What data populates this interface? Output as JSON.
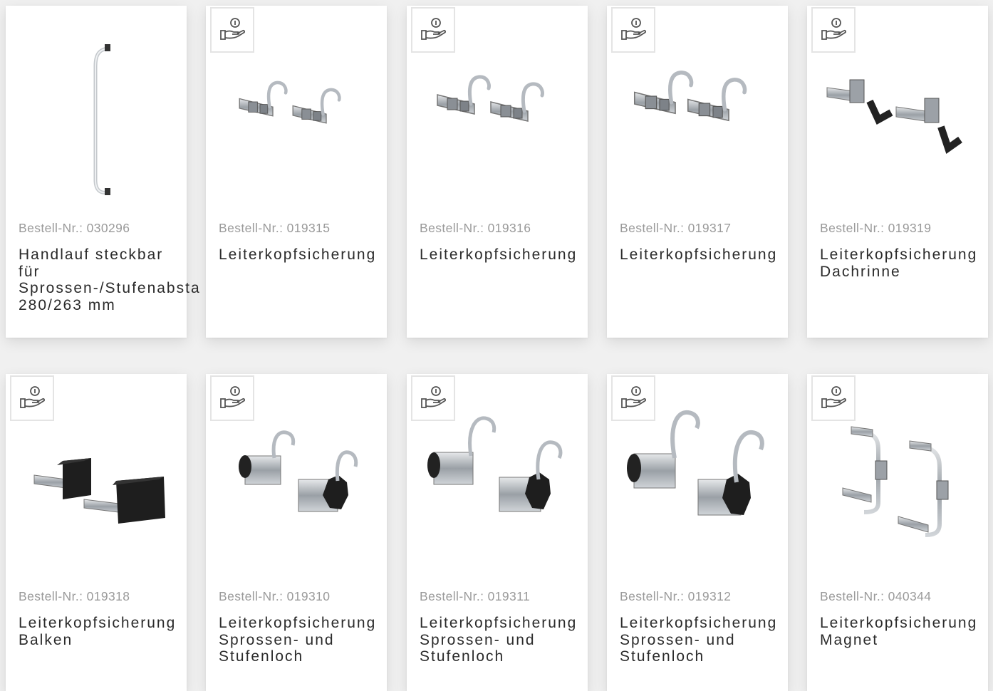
{
  "products": [
    {
      "sku": "Bestell-Nr.: 030296",
      "title": "Handlauf steckbar\nfür\nSprossen-/Stufenabsta\n280/263 mm",
      "badge": false,
      "image_icon": "handrail-image"
    },
    {
      "sku": "Bestell-Nr.: 019315",
      "title": "Leiterkopfsicherung",
      "badge": true,
      "image_icon": "ladder-hook-pair-image"
    },
    {
      "sku": "Bestell-Nr.: 019316",
      "title": "Leiterkopfsicherung",
      "badge": true,
      "image_icon": "ladder-hook-pair-image"
    },
    {
      "sku": "Bestell-Nr.: 019317",
      "title": "Leiterkopfsicherung",
      "badge": true,
      "image_icon": "ladder-hook-pair-image"
    },
    {
      "sku": "Bestell-Nr.: 019319",
      "title": "Leiterkopfsicherung\nDachrinne",
      "badge": true,
      "image_icon": "gutter-hook-pair-image"
    },
    {
      "sku": "Bestell-Nr.: 019318",
      "title": "Leiterkopfsicherung\nBalken",
      "badge": true,
      "image_icon": "beam-bracket-pair-image"
    },
    {
      "sku": "Bestell-Nr.: 019310",
      "title": "Leiterkopfsicherung\nSprossen- und\nStufenloch",
      "badge": true,
      "image_icon": "knob-hook-pair-image"
    },
    {
      "sku": "Bestell-Nr.: 019311",
      "title": "Leiterkopfsicherung\nSprossen- und\nStufenloch",
      "badge": true,
      "image_icon": "knob-hook-pair-image"
    },
    {
      "sku": "Bestell-Nr.: 019312",
      "title": "Leiterkopfsicherung\nSprossen- und\nStufenloch",
      "badge": true,
      "image_icon": "knob-hook-pair-image"
    },
    {
      "sku": "Bestell-Nr.: 040344",
      "title": "Leiterkopfsicherung\nMagnet",
      "badge": true,
      "image_icon": "magnet-bracket-pair-image"
    }
  ],
  "badge_icon": "hand-coin-icon"
}
